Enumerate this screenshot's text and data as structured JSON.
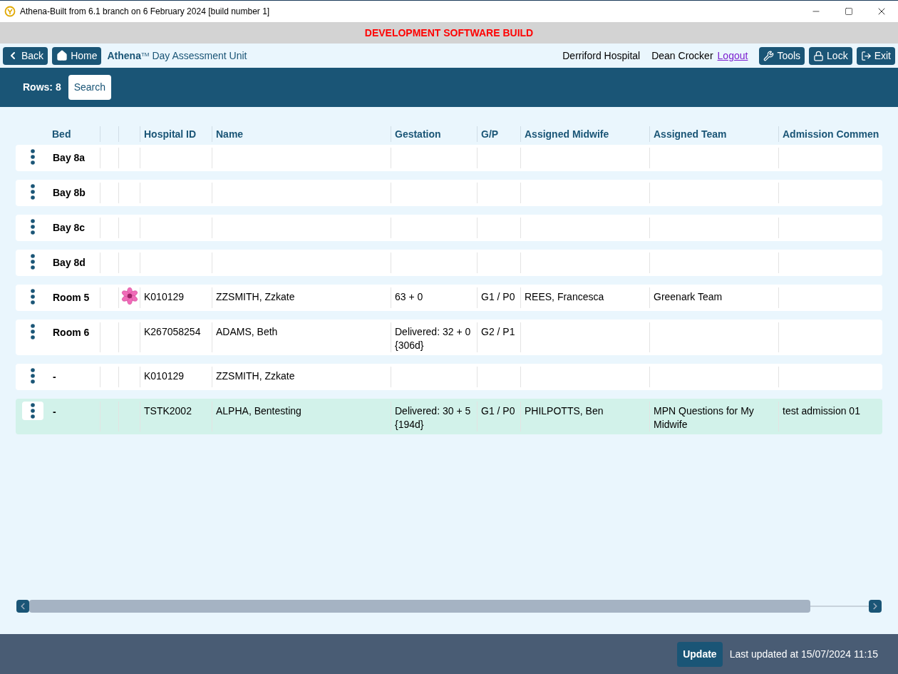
{
  "window": {
    "title": "Athena-Built from 6.1 branch on 6 February 2024 [build number 1]"
  },
  "banner": "DEVELOPMENT SOFTWARE BUILD",
  "nav": {
    "back": "Back",
    "home": "Home",
    "app_title": "**Athena**$^{TM}$ Day Assessment Unit",
    "hospital": "Derriford Hospital",
    "user": "Dean Crocker",
    "logout": "Logout",
    "tools": "Tools",
    "lock": "Lock",
    "exit": "Exit"
  },
  "toolbar": {
    "rows": "Rows: 8",
    "search": "Search"
  },
  "table": {
    "columns": [
      "Bed",
      "",
      "",
      "Hospital ID",
      "Name",
      "Gestation",
      "G/P",
      "Assigned Midwife",
      "Assigned Team",
      "Admission Commen"
    ],
    "rows": [
      {
        "bed": "Bay 8a",
        "flower": false,
        "hospital_id": "",
        "name": "",
        "gestation": "",
        "gp": "",
        "midwife": "",
        "team": "",
        "comment": "",
        "selected": false
      },
      {
        "bed": "Bay 8b",
        "flower": false,
        "hospital_id": "",
        "name": "",
        "gestation": "",
        "gp": "",
        "midwife": "",
        "team": "",
        "comment": "",
        "selected": false
      },
      {
        "bed": "Bay 8c",
        "flower": false,
        "hospital_id": "",
        "name": "",
        "gestation": "",
        "gp": "",
        "midwife": "",
        "team": "",
        "comment": "",
        "selected": false
      },
      {
        "bed": "Bay 8d",
        "flower": false,
        "hospital_id": "",
        "name": "",
        "gestation": "",
        "gp": "",
        "midwife": "",
        "team": "",
        "comment": "",
        "selected": false
      },
      {
        "bed": "Room 5",
        "flower": true,
        "hospital_id": "K010129",
        "name": "ZZSMITH, Zzkate",
        "gestation": "63 + 0",
        "gp": "G1 / P0",
        "midwife": "REES, Francesca",
        "team": "Greenark Team",
        "comment": "",
        "selected": false
      },
      {
        "bed": "Room 6",
        "flower": false,
        "hospital_id": "K267058254",
        "name": "ADAMS, Beth",
        "gestation": "Delivered: 32 + 0 {306d}",
        "gp": "G2 / P1",
        "midwife": "",
        "team": "",
        "comment": "",
        "selected": false
      },
      {
        "bed": "-",
        "flower": false,
        "hospital_id": "K010129",
        "name": "ZZSMITH, Zzkate",
        "gestation": "",
        "gp": "",
        "midwife": "",
        "team": "",
        "comment": "",
        "selected": false
      },
      {
        "bed": "-",
        "flower": false,
        "hospital_id": "TSTK2002",
        "name": "ALPHA, Bentesting",
        "gestation": "Delivered: 30 + 5 {194d}",
        "gp": "G1 / P0",
        "midwife": "PHILPOTTS, Ben",
        "team": "MPN Questions for My Midwife",
        "comment": "test admission 01",
        "selected": true
      }
    ]
  },
  "footer": {
    "update": "Update",
    "last_updated": "Last updated at 15/07/2024 11:15"
  }
}
